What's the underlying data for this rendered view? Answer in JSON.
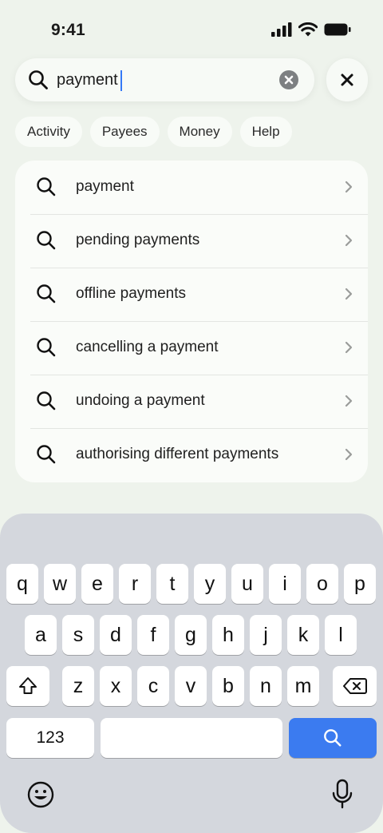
{
  "status_bar": {
    "time": "9:41"
  },
  "search": {
    "value": "payment",
    "placeholder": ""
  },
  "chips": [
    "Activity",
    "Payees",
    "Money",
    "Help"
  ],
  "results": [
    "payment",
    "pending payments",
    "offline payments",
    "cancelling a payment",
    "undoing a payment",
    "authorising different payments"
  ],
  "keyboard": {
    "row1": [
      "q",
      "w",
      "e",
      "r",
      "t",
      "y",
      "u",
      "i",
      "o",
      "p"
    ],
    "row2": [
      "a",
      "s",
      "d",
      "f",
      "g",
      "h",
      "j",
      "k",
      "l"
    ],
    "row3": [
      "z",
      "x",
      "c",
      "v",
      "b",
      "n",
      "m"
    ],
    "numbers_label": "123",
    "search_key_color": "#3b7bf0"
  },
  "icons": {
    "search": "search-icon",
    "clear": "clear-icon",
    "close": "close-icon",
    "chevron": "chevron-right-icon",
    "shift": "shift-icon",
    "backspace": "backspace-icon",
    "emoji": "emoji-icon",
    "mic": "microphone-icon"
  }
}
